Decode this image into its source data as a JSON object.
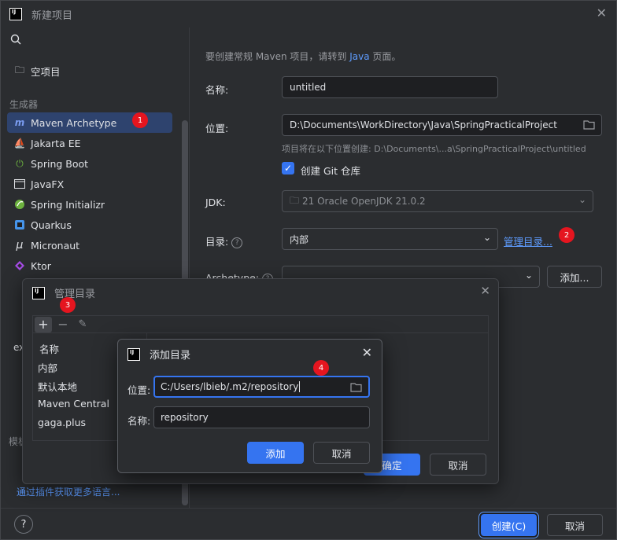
{
  "window": {
    "title": "新建项目"
  },
  "sidebar": {
    "empty_project": "空项目",
    "generators_label": "生成器",
    "items": [
      {
        "label": "Maven Archetype",
        "icon": "maven-icon"
      },
      {
        "label": "Jakarta EE",
        "icon": "jakarta-icon"
      },
      {
        "label": "Spring Boot",
        "icon": "spring-boot-icon"
      },
      {
        "label": "JavaFX",
        "icon": "javafx-icon"
      },
      {
        "label": "Spring Initializr",
        "icon": "spring-initializr-icon"
      },
      {
        "label": "Quarkus",
        "icon": "quarkus-icon"
      },
      {
        "label": "Micronaut",
        "icon": "micronaut-icon"
      },
      {
        "label": "Ktor",
        "icon": "ktor-icon"
      }
    ],
    "partial_ex": "ex",
    "partial_section": "模板",
    "plugins_link": "通过插件获取更多语言..."
  },
  "form": {
    "hint_prefix": "要创建常规 Maven 项目，请转到 ",
    "hint_java": "Java",
    "hint_suffix": " 页面。",
    "name_label": "名称:",
    "name_value": "untitled",
    "location_label": "位置:",
    "location_value": "D:\\Documents\\WorkDirectory\\Java\\SpringPracticalProject",
    "location_hint": "项目将在以下位置创建: D:\\Documents\\...a\\SpringPracticalProject\\untitled",
    "git_label": "创建 Git 仓库",
    "jdk_label": "JDK:",
    "jdk_value": "21 Oracle OpenJDK 21.0.2",
    "catalog_label": "目录:",
    "catalog_value": "内部",
    "manage_link": "管理目录...",
    "archetype_label": "Archetype:",
    "add_button": "添加..."
  },
  "bottom": {
    "help": "?",
    "create": "创建(C)",
    "cancel": "取消"
  },
  "manage_dialog": {
    "title": "管理目录",
    "column": "名称",
    "rows": [
      "内部",
      "默认本地",
      "Maven Central",
      "gaga.plus"
    ],
    "ok": "确定",
    "cancel": "取消"
  },
  "add_dialog": {
    "title": "添加目录",
    "location_label": "位置:",
    "location_value": "C:/Users/lbieb/.m2/repository",
    "name_label": "名称:",
    "name_value": "repository",
    "add": "添加",
    "cancel": "取消"
  },
  "badges": [
    "1",
    "2",
    "3",
    "4"
  ],
  "colors": {
    "accent": "#3574f0",
    "badge": "#e5151f",
    "link": "#5e9cff",
    "selection": "#2e436e"
  }
}
